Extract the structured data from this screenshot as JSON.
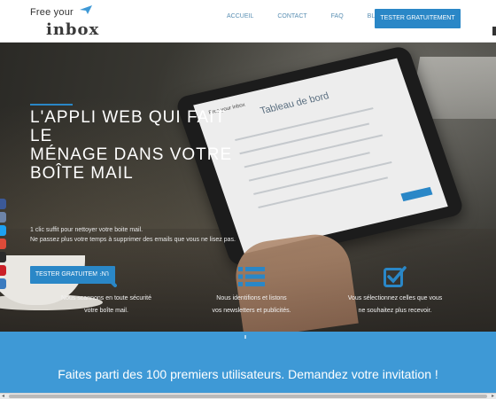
{
  "brand": {
    "logo_top": "Free your",
    "logo_bottom": "inbox"
  },
  "nav": {
    "links": [
      "ACCUEIL",
      "CONTACT",
      "FAQ",
      "BLOG"
    ],
    "cta": "TESTER GRATUITEMENT"
  },
  "hero": {
    "title_lines": [
      "L'APPLI WEB QUI FAIT",
      "LE",
      "MÉNAGE DANS VOTRE",
      "BOÎTE MAIL"
    ],
    "sub_lines": [
      "1 clic suffit pour nettoyer votre boite mail.",
      "Ne passez plus votre temps à supprimer des emails que vous ne lisez pas."
    ],
    "cta": "TESTER GRATUITEMENT",
    "tablet_title": "Tableau de bord",
    "tablet_logo": "Free your inbox"
  },
  "features": [
    {
      "icon": "search-icon",
      "lines": [
        "Nous scannons en toute sécurité",
        "votre boîte mail."
      ]
    },
    {
      "icon": "list-icon",
      "lines": [
        "Nous identifions et listons",
        "vos newsletters et publicités."
      ]
    },
    {
      "icon": "checkbox-icon",
      "lines": [
        "Vous sélectionnez celles que vous",
        "ne souhaitez plus recevoir."
      ]
    }
  ],
  "invite": {
    "text": "Faites parti des 100 premiers utilisateurs. Demandez votre invitation !"
  },
  "social": [
    {
      "icon": "facebook-icon",
      "color": "#3b5998"
    },
    {
      "icon": "print-icon",
      "color": "#6d84a8"
    },
    {
      "icon": "twitter-icon",
      "color": "#1da1f2"
    },
    {
      "icon": "google-plus-icon",
      "color": "#dd4b39"
    },
    {
      "icon": "buffer-icon",
      "color": "#2b2b2b"
    },
    {
      "icon": "pinterest-icon",
      "color": "#cb2027"
    },
    {
      "icon": "share-icon",
      "color": "#3b7bbf"
    }
  ],
  "colors": {
    "accent": "#2a87c7",
    "band": "#3e99d6",
    "nav_link": "#5a8fb3"
  }
}
